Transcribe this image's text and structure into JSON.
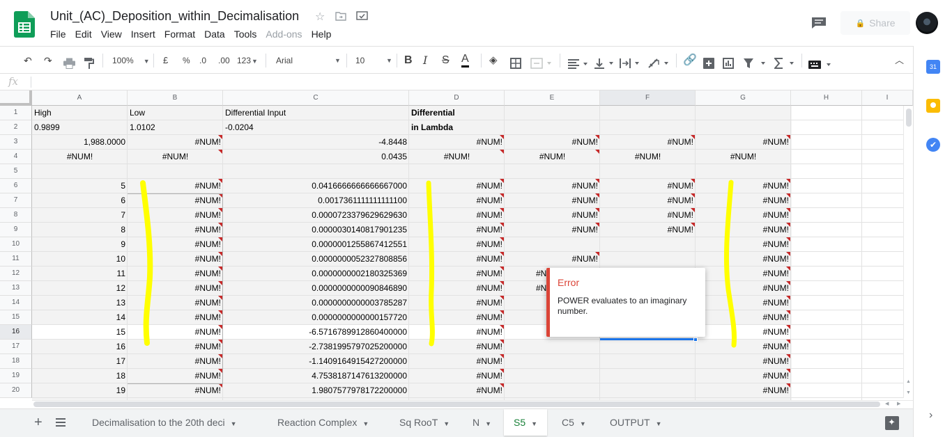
{
  "app": {
    "title": "Unit_(AC)_Deposition_within_Decimalisation",
    "menu": [
      "File",
      "Edit",
      "View",
      "Insert",
      "Format",
      "Data",
      "Tools",
      "Add-ons",
      "Help"
    ],
    "share_label": "Share"
  },
  "toolbar": {
    "zoom": "100%",
    "currency": "£",
    "percent": "%",
    "dec_decrease": ".0",
    "dec_increase": ".00",
    "more_formats": "123",
    "font": "Arial",
    "font_size": "10",
    "bold": "B",
    "italic": "I",
    "strike": "S",
    "text_color": "A"
  },
  "formula_bar": {
    "fx": "fx",
    "value": ""
  },
  "columns": [
    "A",
    "B",
    "C",
    "D",
    "E",
    "F",
    "G",
    "H",
    "I"
  ],
  "rows": [
    "1",
    "2",
    "3",
    "4",
    "5",
    "6",
    "7",
    "8",
    "9",
    "10",
    "11",
    "12",
    "13",
    "14",
    "15",
    "16",
    "17",
    "18",
    "19",
    "20"
  ],
  "cells": {
    "A1": "High",
    "B1": "Low",
    "C1": "Differential Input",
    "D1": "Differential",
    "A2": "0.9899",
    "B2": "1.0102",
    "C2": "-0.0204",
    "D2": "in Lambda",
    "A3": "1,988.0000",
    "B3": "#NUM!",
    "C3": "-4.8448",
    "D3": "#NUM!",
    "E3": "#NUM!",
    "F3": "#NUM!",
    "G3": "#NUM!",
    "A4": "#NUM!",
    "B4": "#NUM!",
    "C4": "0.0435",
    "D4": "#NUM!",
    "E4": "#NUM!",
    "F4": "#NUM!",
    "G4": "#NUM!",
    "A6": "5",
    "B6": "#NUM!",
    "C6": "0.0416666666666667000",
    "D6": "#NUM!",
    "E6": "#NUM!",
    "F6": "#NUM!",
    "G6": "#NUM!",
    "A7": "6",
    "B7": "#NUM!",
    "C7": "0.0017361111111111100",
    "D7": "#NUM!",
    "E7": "#NUM!",
    "F7": "#NUM!",
    "G7": "#NUM!",
    "A8": "7",
    "B8": "#NUM!",
    "C8": "0.0000723379629629630",
    "D8": "#NUM!",
    "E8": "#NUM!",
    "F8": "#NUM!",
    "G8": "#NUM!",
    "A9": "8",
    "B9": "#NUM!",
    "C9": "0.0000030140817901235",
    "D9": "#NUM!",
    "E9": "#NUM!",
    "F9": "#NUM!",
    "G9": "#NUM!",
    "A10": "9",
    "B10": "#NUM!",
    "C10": "0.0000001255867412551",
    "D10": "#NUM!",
    "G10": "#NUM!",
    "A11": "10",
    "B11": "#NUM!",
    "C11": "0.0000000052327808856",
    "D11": "#NUM!",
    "E11": "#NUM!",
    "G11": "#NUM!",
    "A12": "11",
    "B12": "#NUM!",
    "C12": "0.0000000002180325369",
    "D12": "#NUM!",
    "E12": "#N",
    "G12": "#NUM!",
    "A13": "12",
    "B13": "#NUM!",
    "C13": "0.0000000000090846890",
    "D13": "#NUM!",
    "E13": "#N",
    "G13": "#NUM!",
    "A14": "13",
    "B14": "#NUM!",
    "C14": "0.0000000000003785287",
    "D14": "#NUM!",
    "G14": "#NUM!",
    "A15": "14",
    "B15": "#NUM!",
    "C15": "0.0000000000000157720",
    "D15": "#NUM!",
    "G15": "#NUM!",
    "A16": "15",
    "B16": "#NUM!",
    "C16": "-6.5716789912860400000",
    "D16": "#NUM!",
    "G16": "#NUM!",
    "A17": "16",
    "B17": "#NUM!",
    "C17": "-2.7381995797025200000",
    "D17": "#NUM!",
    "G17": "#NUM!",
    "A18": "17",
    "B18": "#NUM!",
    "C18": "-1.1409164915427200000",
    "D18": "#NUM!",
    "G18": "#NUM!",
    "A19": "18",
    "B19": "#NUM!",
    "C19": "4.7538187147613200000",
    "D19": "#NUM!",
    "G19": "#NUM!",
    "A20": "19",
    "B20": "#NUM!",
    "C20": "1.9807577978172200000",
    "D20": "#NUM!",
    "G20": "#NUM!"
  },
  "error_popup": {
    "title": "Error",
    "message": "POWER evaluates to an imaginary number."
  },
  "sheet_tabs": [
    {
      "label": "Decimalisation to the 20th deci",
      "active": false
    },
    {
      "label": "Reaction Complex",
      "active": false
    },
    {
      "label": "Sq RooT",
      "active": false
    },
    {
      "label": "N",
      "active": false
    },
    {
      "label": "S5",
      "active": true
    },
    {
      "label": "C5",
      "active": false
    },
    {
      "label": "OUTPUT",
      "active": false
    }
  ],
  "side_panel": {
    "calendar_day": "31"
  },
  "colors": {
    "accent_green": "#188038",
    "error_red": "#db4437",
    "highlight_yellow": "#ffff00",
    "selection_blue": "#1a73e8"
  }
}
